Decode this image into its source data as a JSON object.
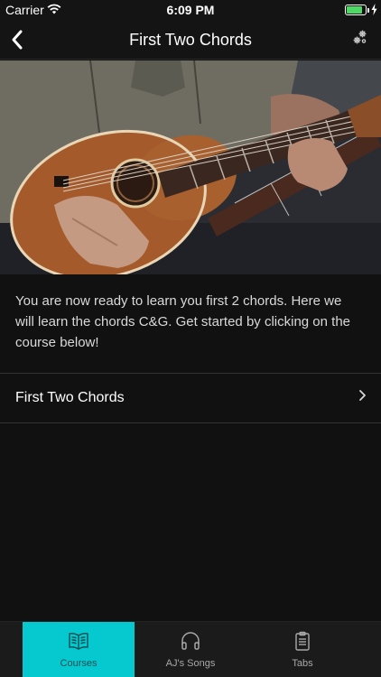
{
  "status_bar": {
    "carrier": "Carrier",
    "time": "6:09 PM",
    "battery_level": 0.85,
    "battery_color": "#4cd964"
  },
  "nav": {
    "title": "First Two Chords",
    "back_icon": "back-chevron-icon",
    "settings_icon": "gears-icon"
  },
  "intro_text": "You are now ready to learn you first 2 chords. Here we will learn the chords C&G. Get started by clicking on the course below!",
  "courses": [
    {
      "label": "First Two Chords"
    }
  ],
  "tabs": [
    {
      "label": "Courses",
      "icon": "book-icon",
      "active": true
    },
    {
      "label": "AJ's Songs",
      "icon": "headphones-icon",
      "active": false
    },
    {
      "label": "Tabs",
      "icon": "clipboard-icon",
      "active": false
    }
  ],
  "colors": {
    "accent": "#06c8cf",
    "background": "#111111",
    "bar": "#141414"
  }
}
